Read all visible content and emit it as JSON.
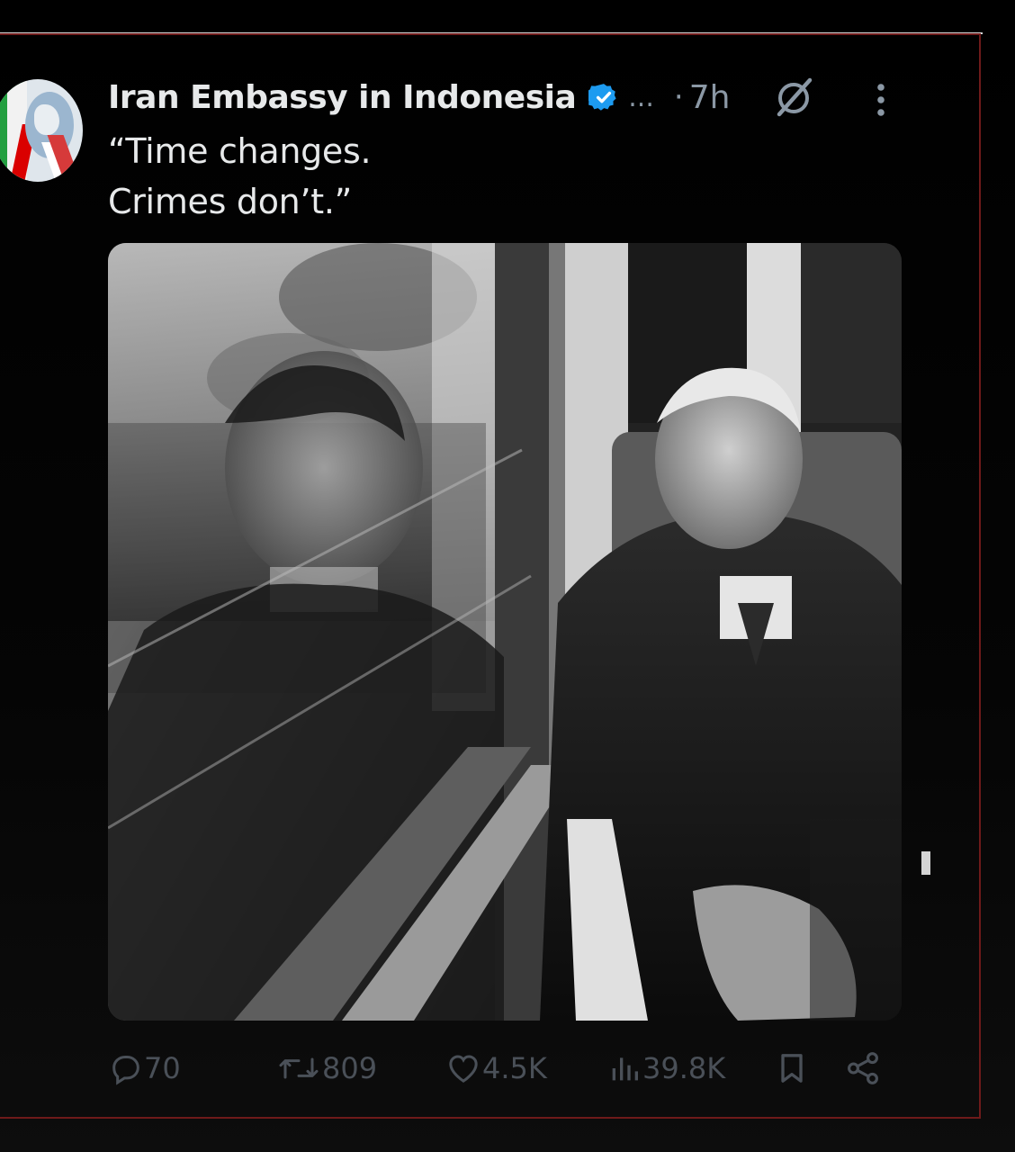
{
  "tweet": {
    "author_name": "Iran Embassy in Indonesia",
    "more_label": "...",
    "separator": "·",
    "time": "7h",
    "text_line_1": "“Time changes.",
    "text_line_2": "Crimes don’t.”",
    "verified_color": "#1d9bf0"
  },
  "actions": {
    "replies": "70",
    "reposts": "809",
    "likes": "4.5K",
    "views": "39.8K"
  },
  "icons": {
    "verified": "verified-badge-icon",
    "grok": "grok-icon",
    "menu": "more-vertical-icon",
    "reply": "reply-icon",
    "repost": "repost-icon",
    "like": "heart-icon",
    "views": "views-icon",
    "bookmark": "bookmark-icon",
    "share": "share-icon"
  }
}
